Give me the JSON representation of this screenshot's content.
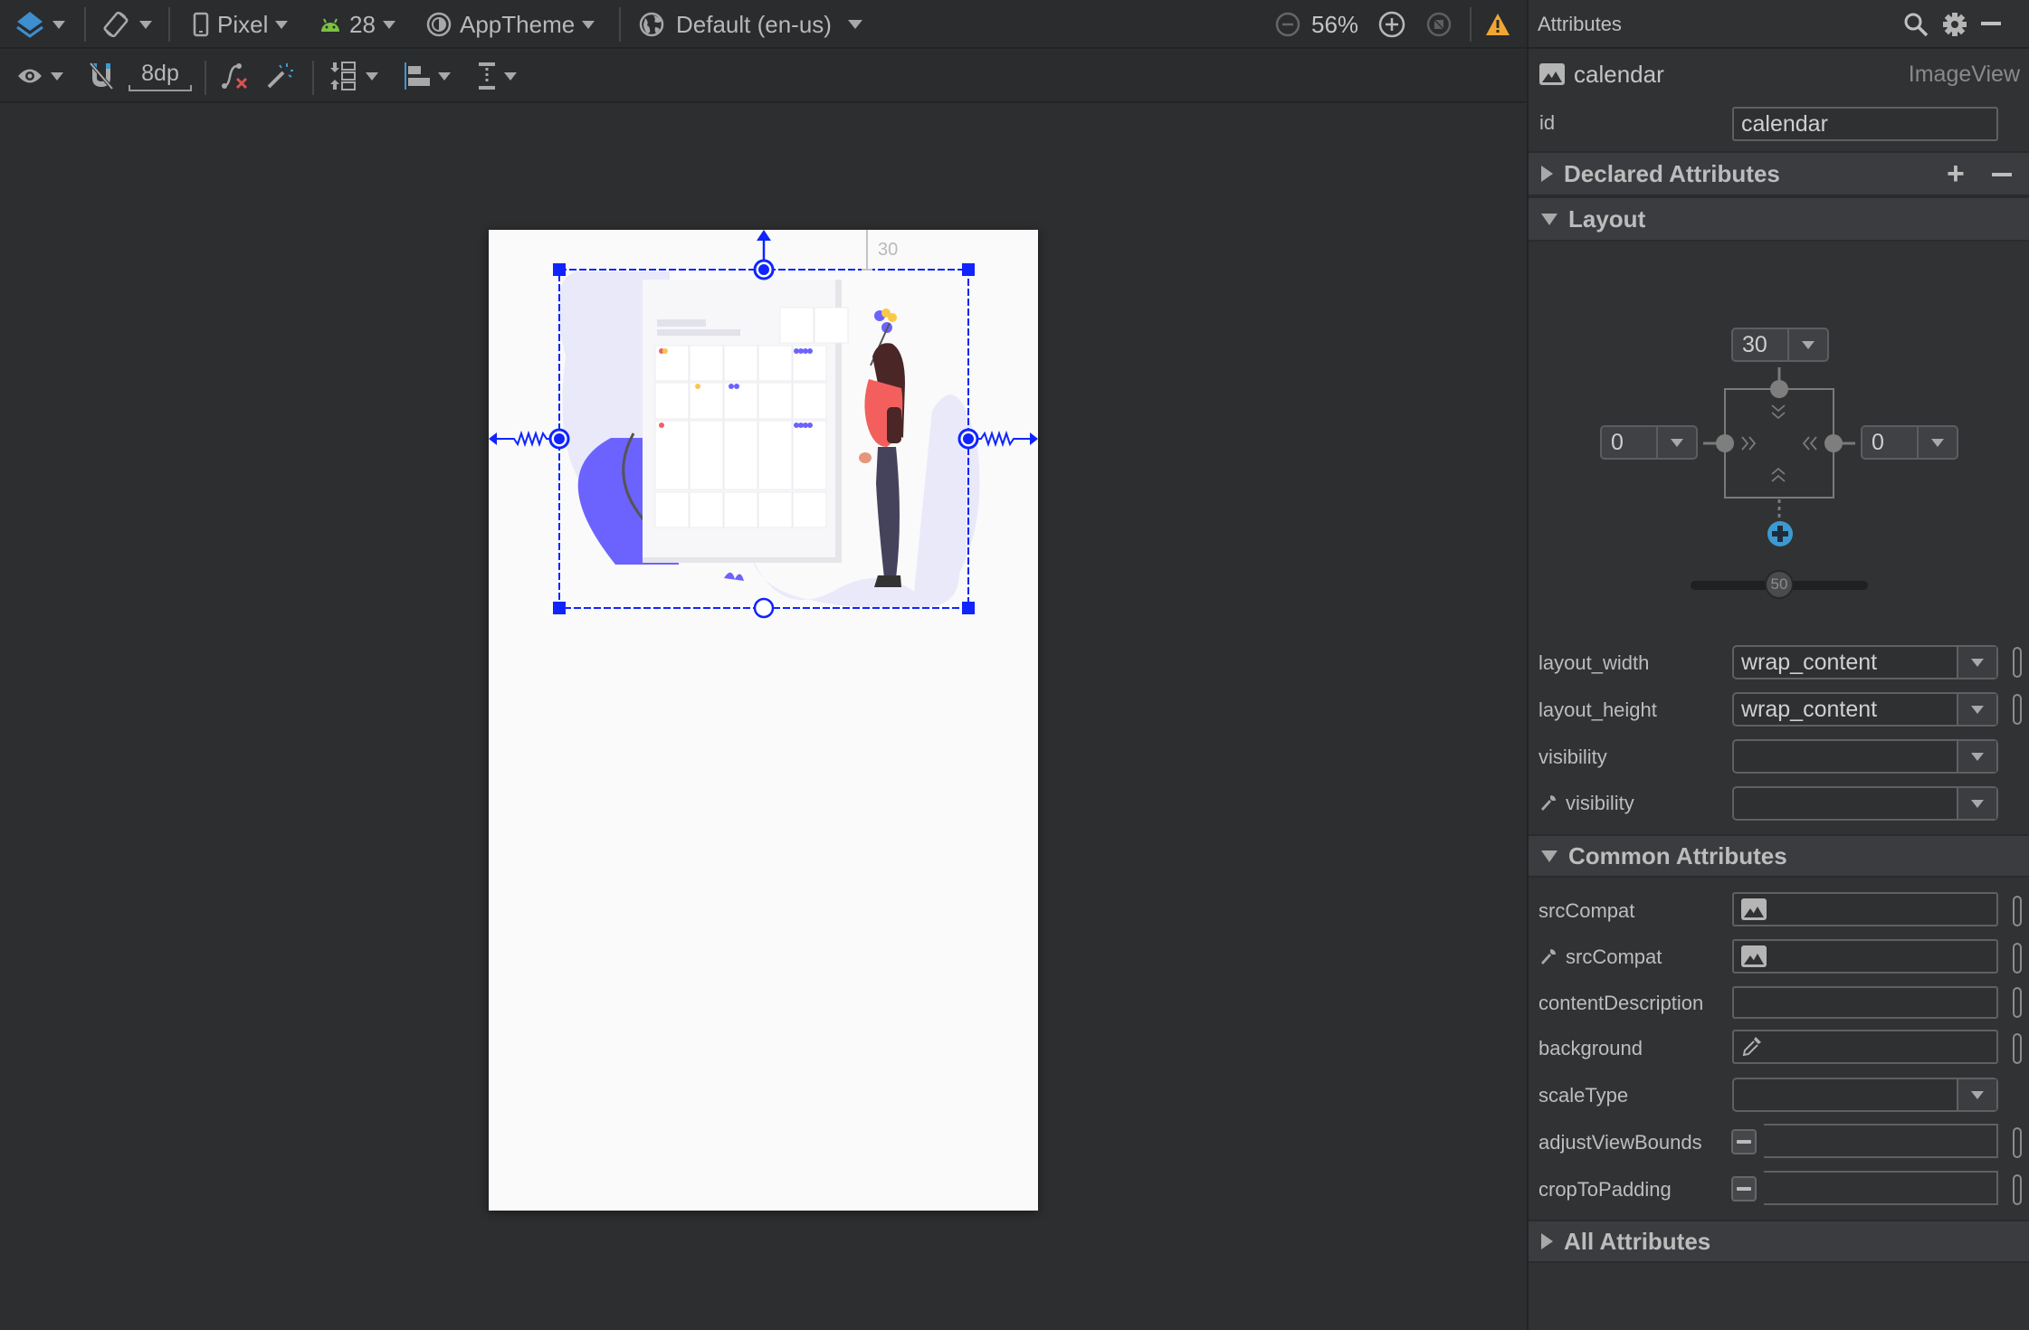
{
  "toolbar": {
    "design_surface_icon": "layers-icon",
    "orientation_icon": "rotate-device-icon",
    "device": "Pixel",
    "api_level": "28",
    "theme": "AppTheme",
    "locale": "Default (en-us)",
    "zoom_level": "56%",
    "warning_icon": "warning-icon"
  },
  "toolbar2": {
    "view_options_icon": "eye-icon",
    "autoconnect_icon": "magnet-off-icon",
    "default_margin": "8dp",
    "clear_constraints_icon": "clear-constraints-icon",
    "infer_constraints_icon": "magic-wand-icon",
    "pack_icon": "pack-icon",
    "align_icon": "align-left-icon",
    "guidelines_icon": "guidelines-icon"
  },
  "canvas": {
    "selected_view_top_margin": "30",
    "accent": "#0f24ff"
  },
  "panel": {
    "title": "Attributes",
    "component_name": "calendar",
    "component_type": "ImageView",
    "id_label": "id",
    "id_value": "calendar",
    "sections": {
      "declared": "Declared Attributes",
      "layout": "Layout",
      "common": "Common Attributes",
      "all": "All Attributes"
    },
    "constraint_widget": {
      "top_margin": "30",
      "left_margin": "0",
      "right_margin": "0",
      "bias": "50",
      "bias_fraction": 0.5
    },
    "layout_attrs": [
      {
        "label": "layout_width",
        "value": "wrap_content"
      },
      {
        "label": "layout_height",
        "value": "wrap_content"
      },
      {
        "label": "visibility",
        "value": ""
      },
      {
        "label": "visibility",
        "value": "",
        "tools": true
      }
    ],
    "common_attrs": [
      {
        "label": "srcCompat",
        "value": ""
      },
      {
        "label": "srcCompat",
        "value": "",
        "tools": true
      },
      {
        "label": "contentDescription",
        "value": ""
      },
      {
        "label": "background",
        "value": ""
      },
      {
        "label": "scaleType",
        "value": ""
      },
      {
        "label": "adjustViewBounds",
        "value": ""
      },
      {
        "label": "cropToPadding",
        "value": ""
      }
    ],
    "accent_blue": "#3d9ad1",
    "warning_color": "#f0a732"
  }
}
